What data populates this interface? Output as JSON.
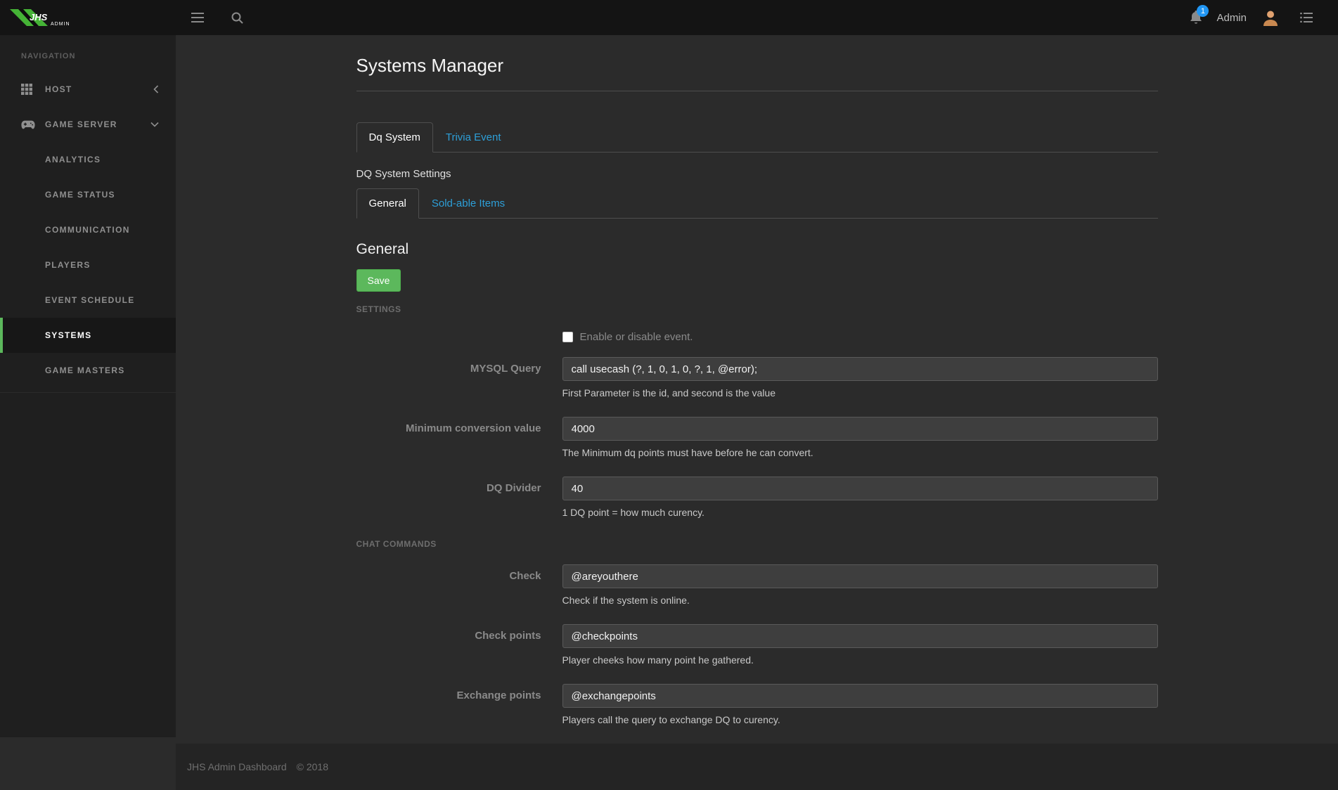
{
  "topbar": {
    "brand_name": "JHS",
    "brand_suffix": "ADMIN",
    "notification_count": "1",
    "user_name": "Admin"
  },
  "icons": {
    "menu": "hamburger-lines",
    "search": "magnifier",
    "notifications": "bell",
    "user_menu": "list-lines",
    "host": "grid",
    "game_server": "gamepad",
    "host_state_chevron": "chevron-left",
    "game_server_state_chevron": "chevron-down"
  },
  "sidebar": {
    "section_title": "NAVIGATION",
    "items": [
      {
        "label": "HOST",
        "state": "collapsed"
      },
      {
        "label": "GAME SERVER",
        "state": "expanded"
      }
    ],
    "game_server_children": [
      {
        "label": "ANALYTICS",
        "active": false
      },
      {
        "label": "GAME STATUS",
        "active": false
      },
      {
        "label": "COMMUNICATION",
        "active": false
      },
      {
        "label": "PLAYERS",
        "active": false
      },
      {
        "label": "EVENT SCHEDULE",
        "active": false
      },
      {
        "label": "SYSTEMS",
        "active": true
      },
      {
        "label": "GAME MASTERS",
        "active": false
      }
    ]
  },
  "main": {
    "page_title": "Systems Manager",
    "tabs": [
      {
        "label": "Dq System",
        "active": true
      },
      {
        "label": "Trivia Event",
        "active": false
      }
    ],
    "section_label": "DQ System Settings",
    "subtabs": [
      {
        "label": "General",
        "active": true
      },
      {
        "label": "Sold-able Items",
        "active": false
      }
    ],
    "panel_title": "General",
    "save_button": "Save",
    "settings_group_label": "SETTINGS",
    "enable_checkbox_label": "Enable or disable event.",
    "enable_checkbox_checked": false,
    "settings_fields": [
      {
        "label": "MYSQL Query",
        "value": "call usecash (?, 1, 0, 1, 0, ?, 1, @error);",
        "help": "First Parameter is the id, and second is the value"
      },
      {
        "label": "Minimum conversion value",
        "value": "4000",
        "help": "The Minimum dq points must have before he can convert."
      },
      {
        "label": "DQ Divider",
        "value": "40",
        "help": "1 DQ point = how much curency."
      }
    ],
    "chat_group_label": "CHAT COMMANDS",
    "chat_fields": [
      {
        "label": "Check",
        "value": "@areyouthere",
        "help": "Check if the system is online."
      },
      {
        "label": "Check points",
        "value": "@checkpoints",
        "help": "Player cheeks how many point he gathered."
      },
      {
        "label": "Exchange points",
        "value": "@exchangepoints",
        "help": "Players call the query to exchange DQ to curency."
      }
    ]
  },
  "footer": {
    "brand": "JHS Admin Dashboard",
    "copyright": "© 2018"
  },
  "colors": {
    "accent_green": "#5cb85c",
    "link_blue": "#2d9fd8",
    "badge_blue": "#2196f3",
    "topbar_bg": "#141414",
    "sidebar_bg": "#1f1f1f",
    "main_bg": "#2b2b2b",
    "footer_bg": "#242424"
  }
}
